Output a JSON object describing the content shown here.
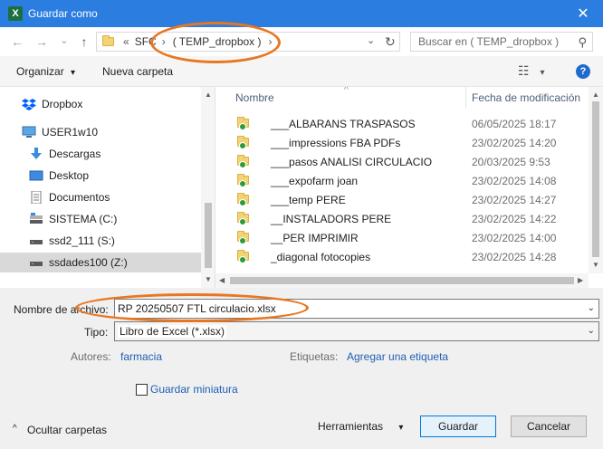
{
  "window": {
    "title": "Guardar como",
    "app_icon": "X",
    "close_glyph": "✕"
  },
  "address": {
    "back_glyph": "←",
    "forward_glyph": "→",
    "history_glyph": "⌄",
    "up_glyph": "↑",
    "overflow": "«",
    "crumbs": [
      "SFC",
      "( TEMP_dropbox )"
    ],
    "sep_glyph": "›",
    "dropdown_glyph": "⌄",
    "refresh_glyph": "↻",
    "search_placeholder": "Buscar en ( TEMP_dropbox )",
    "search_glyph": "⚲"
  },
  "toolbar": {
    "organize": "Organizar",
    "organize_caret": "▾",
    "new_folder": "Nueva carpeta",
    "view_glyph": "☷",
    "view_caret": "▾",
    "help": "?"
  },
  "nav": {
    "items": [
      {
        "label": "Dropbox",
        "icon": "dropbox-icon"
      },
      {
        "label": "USER1w10",
        "icon": "computer-icon"
      },
      {
        "label": "Descargas",
        "icon": "downloads-icon"
      },
      {
        "label": "Desktop",
        "icon": "desktop-icon"
      },
      {
        "label": "Documentos",
        "icon": "documents-icon"
      },
      {
        "label": "SISTEMA (C:)",
        "icon": "drive-icon"
      },
      {
        "label": "ssd2_111 (S:)",
        "icon": "drive-icon"
      },
      {
        "label": "ssdades100 (Z:)",
        "icon": "drive-icon"
      }
    ],
    "selected_index": 7
  },
  "files": {
    "col_name": "Nombre",
    "col_date": "Fecha de modificación",
    "sort_glyph": "^",
    "rows": [
      {
        "name": "___ALBARANS TRASPASOS",
        "date": "06/05/2025 18:17"
      },
      {
        "name": "___impressions FBA PDFs",
        "date": "23/02/2025 14:20"
      },
      {
        "name": "___pasos ANALISI CIRCULACIO",
        "date": "20/03/2025 9:53"
      },
      {
        "name": "___expofarm joan",
        "date": "23/02/2025 14:08"
      },
      {
        "name": "___temp PERE",
        "date": "23/02/2025 14:27"
      },
      {
        "name": "__INSTALADORS PERE",
        "date": "23/02/2025 14:22"
      },
      {
        "name": "__PER IMPRIMIR",
        "date": "23/02/2025 14:00"
      },
      {
        "name": "_diagonal fotocopies",
        "date": "23/02/2025 14:28"
      }
    ]
  },
  "form": {
    "filename_label": "Nombre de archivo:",
    "filename_value": "RP 20250507 FTL circulacio.xlsx",
    "type_label": "Tipo:",
    "type_value": "Libro de Excel (*.xlsx)",
    "authors_label": "Autores:",
    "authors_value": "farmacia",
    "tags_label": "Etiquetas:",
    "tags_value": "Agregar una etiqueta",
    "thumbnail_label": "Guardar miniatura",
    "thumbnail_checked": false,
    "dropdown_glyph": "⌄"
  },
  "footer": {
    "hide_folders": "Ocultar carpetas",
    "hide_glyph": "^",
    "tools": "Herramientas",
    "tools_caret": "▾",
    "save": "Guardar",
    "cancel": "Cancelar"
  },
  "colors": {
    "titlebar": "#2b7de0",
    "annotation_ring": "#e87722",
    "sync_ok": "#2e9b3a",
    "folder": "#f4d373",
    "link": "#1f5fb4"
  }
}
